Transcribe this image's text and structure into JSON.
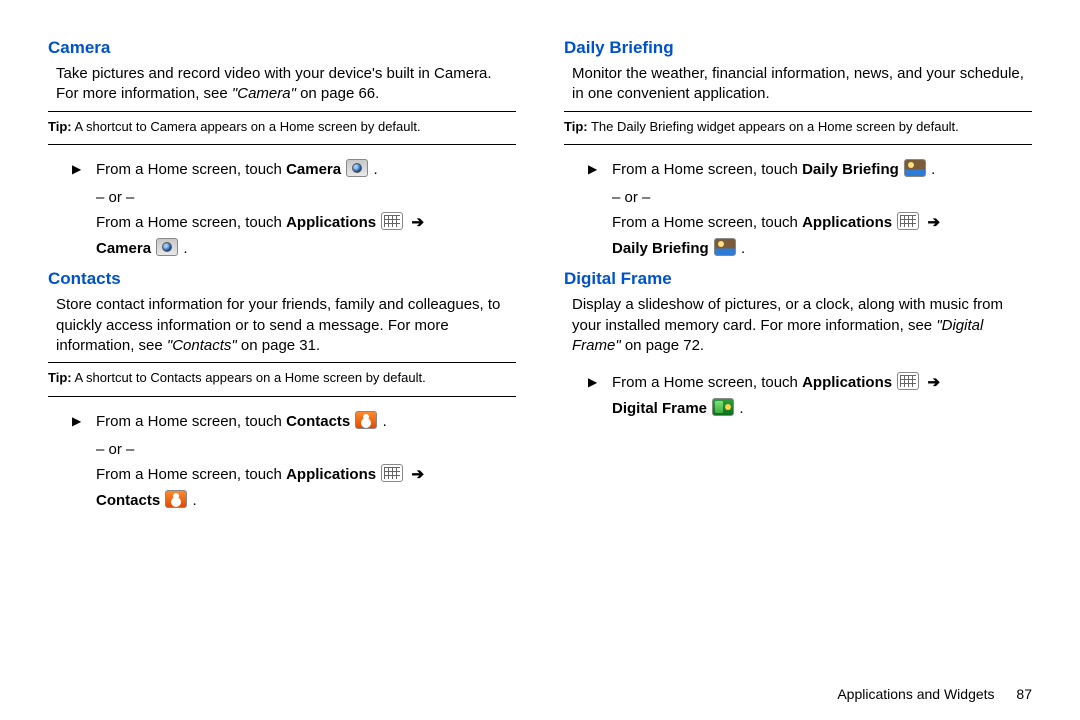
{
  "left": {
    "camera": {
      "heading": "Camera",
      "desc_pre": "Take pictures and record video with your device's built in Camera. For more information, see ",
      "desc_ref": "\"Camera\"",
      "desc_post": " on page 66.",
      "tip_label": "Tip:",
      "tip_text": " A shortcut to Camera appears on a Home screen by default.",
      "step1a": "From a Home screen, touch ",
      "step1b": "Camera",
      "or": "– or –",
      "step2a": "From a Home screen, touch ",
      "step2b": "Applications",
      "step2c": "Camera"
    },
    "contacts": {
      "heading": "Contacts",
      "desc_pre": "Store contact information for your friends, family and colleagues, to quickly access information or to send a message. For more information, see ",
      "desc_ref": "\"Contacts\"",
      "desc_post": " on page 31.",
      "tip_label": "Tip:",
      "tip_text": " A shortcut to Contacts appears on a Home screen by default.",
      "step1a": "From a Home screen, touch ",
      "step1b": "Contacts",
      "or": "– or –",
      "step2a": "From a Home screen, touch ",
      "step2b": "Applications",
      "step2c": "Contacts"
    }
  },
  "right": {
    "briefing": {
      "heading": "Daily Briefing",
      "desc": "Monitor the weather, financial information, news, and your schedule, in one convenient application.",
      "tip_label": "Tip:",
      "tip_text": " The Daily Briefing widget appears on a Home screen by default.",
      "step1a": "From a Home screen, touch ",
      "step1b": "Daily Briefing",
      "or": "– or –",
      "step2a": "From a Home screen, touch ",
      "step2b": "Applications",
      "step2c": "Daily Briefing"
    },
    "frame": {
      "heading": "Digital Frame",
      "desc_pre": "Display a slideshow of pictures, or a clock, along with music from your installed memory card. For more information, see ",
      "desc_ref": "\"Digital Frame\"",
      "desc_post": " on page 72.",
      "step1a": "From a Home screen, touch ",
      "step1b": "Applications",
      "step1c": "Digital Frame"
    }
  },
  "footer": {
    "section": "Applications and Widgets",
    "page": "87"
  },
  "glyphs": {
    "arrow": "➔",
    "period": " ."
  }
}
